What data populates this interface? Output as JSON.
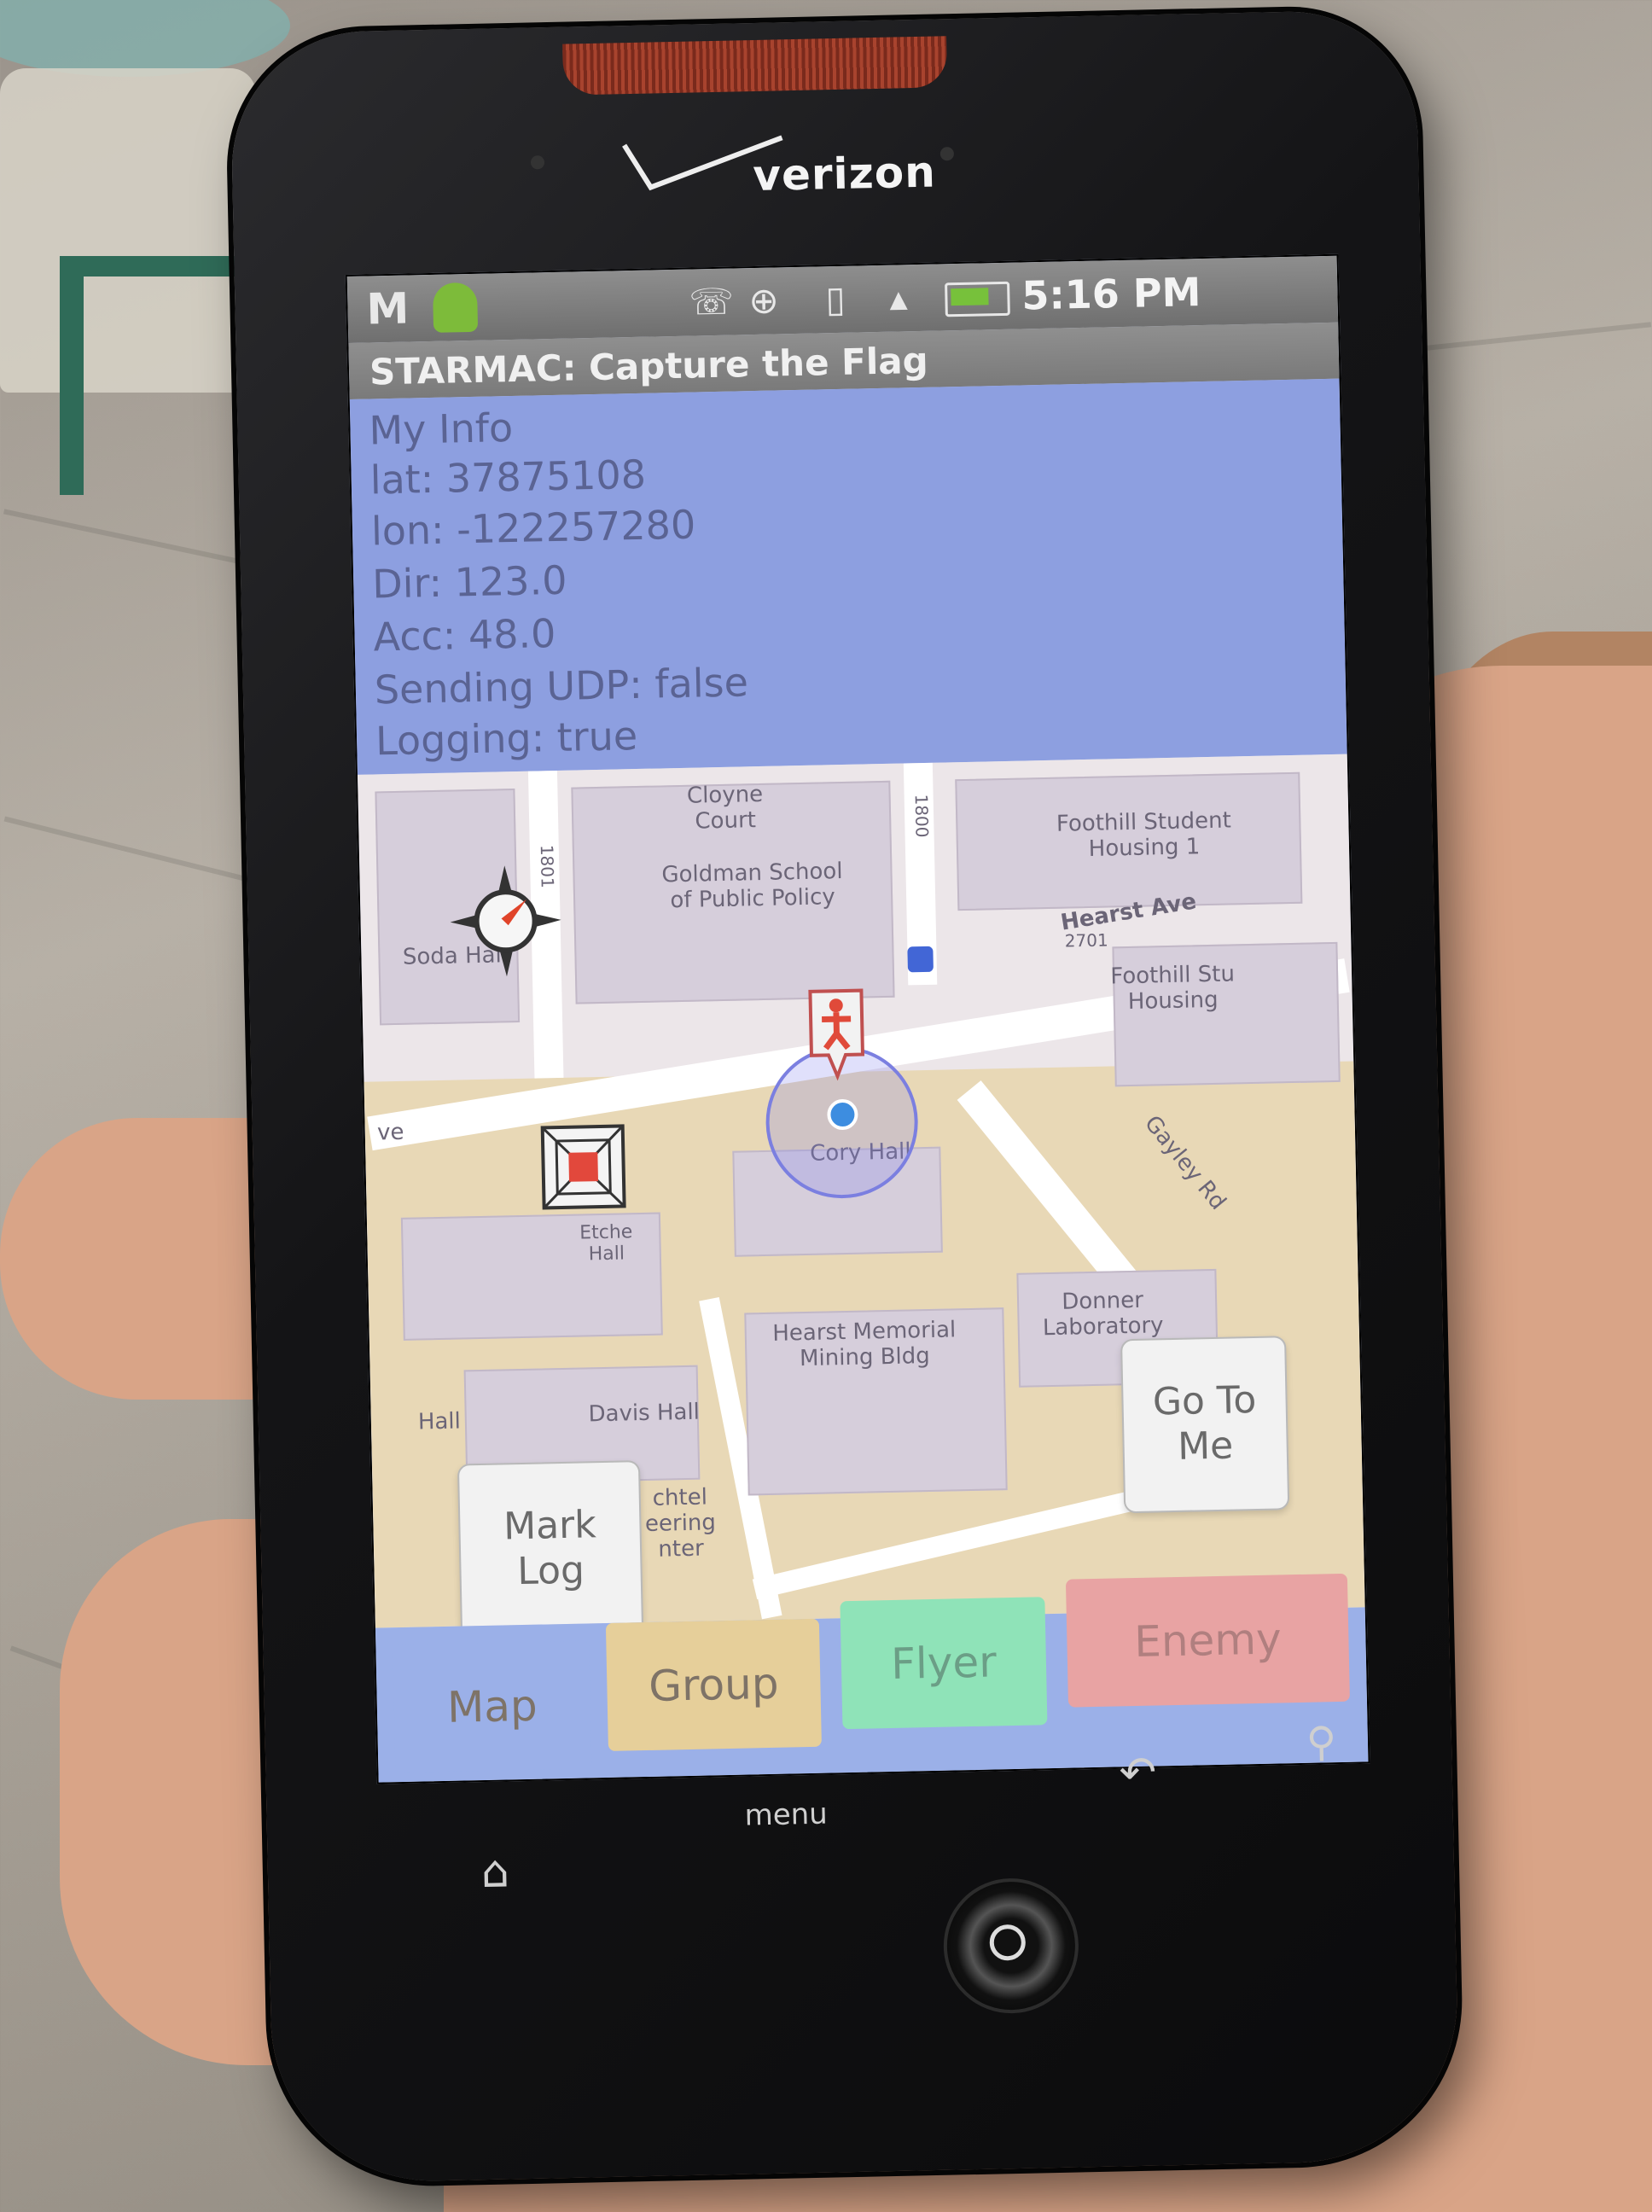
{
  "device": {
    "brand": "verizon",
    "hardware_keys": {
      "menu": "menu",
      "home": "⌂",
      "back": "↶",
      "search": "⚲"
    }
  },
  "status_bar": {
    "left_icon": "M",
    "time": "5:16 PM",
    "icons": [
      "phone-signal-icon",
      "gps-icon",
      "vibrate-icon",
      "network-signal-icon",
      "battery-icon"
    ]
  },
  "app": {
    "title": "STARMAC: Capture the Flag"
  },
  "my_info": {
    "heading": "My Info",
    "lines": [
      "lat: 37875108",
      "lon: -122257280",
      "Dir: 123.0",
      "Acc: 48.0",
      "Sending UDP: false",
      "Logging: true"
    ]
  },
  "map": {
    "labels": {
      "cloyne": "Cloyne\nCourt",
      "goldman": "Goldman School\nof Public Policy",
      "foothill1": "Foothill Student\nHousing 1",
      "soda": "Soda Hall",
      "hearst_ave": "Hearst Ave",
      "foothill2": "Foothill Stu\nHousing",
      "cory": "Cory Hall",
      "gayley": "Gayley Rd",
      "hearst_mining": "Hearst Memorial\nMining Bldg",
      "donner": "Donner\nLaboratory",
      "davis": "Davis Hall",
      "hall_left": "Hall",
      "ve": "ve",
      "bechtel": "chtel\neering\nnter",
      "etcheverry": "Etche\nHall",
      "street_1801": "1801",
      "street_1800": "1800",
      "street_2701": "2701"
    }
  },
  "buttons": {
    "go_to_me": "Go To\nMe",
    "mark_log": "Mark\nLog"
  },
  "tabs": [
    {
      "label": "Map",
      "color": "#9bb0e8"
    },
    {
      "label": "Group",
      "color": "#e6cf9a"
    },
    {
      "label": "Flyer",
      "color": "#8fe3b8"
    },
    {
      "label": "Enemy",
      "color": "#e8a3a3"
    }
  ]
}
